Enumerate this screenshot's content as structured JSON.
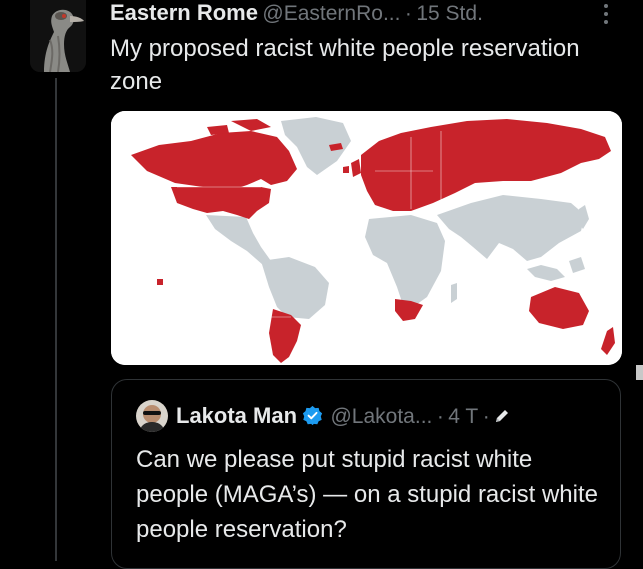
{
  "tweet": {
    "author_name": "Eastern Rome",
    "handle": "@EasternRo...",
    "separator": "·",
    "time": "15 Std.",
    "text": "My proposed racist white people reservation zone"
  },
  "quoted_tweet": {
    "author_name": "Lakota Man",
    "handle": "@Lakota...",
    "separator": "·",
    "time": "4 T",
    "separator2": "·",
    "text": "Can we please put stupid racist white people (MAGA’s) — on a stupid racist white people reservation?"
  },
  "map": {
    "highlight_color": "#c8232b",
    "other_color": "#c9d0d4",
    "highlighted_regions": [
      "Canada",
      "United States",
      "Europe",
      "Russia",
      "Argentina",
      "Chile",
      "South Africa",
      "Australia",
      "New Zealand"
    ]
  },
  "icons": {
    "author_avatar": "emu-avatar",
    "more": "more-options-icon",
    "verified": "verified-badge-icon",
    "edited": "edit-pencil-icon"
  },
  "colors": {
    "background": "#000000",
    "text": "#e7e9ea",
    "secondary_text": "#71767b",
    "border": "#2f3336",
    "verified": "#1d9bf0"
  }
}
